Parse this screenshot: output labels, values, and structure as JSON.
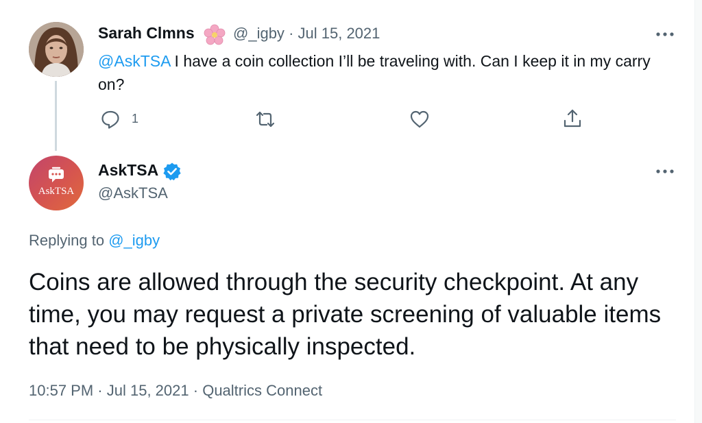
{
  "tweet1": {
    "display_name": "Sarah Clmns",
    "handle": "@_igby",
    "separator": "·",
    "date": "Jul 15, 2021",
    "mention": "@AskTSA",
    "text": " I have a coin collection I’ll be traveling with. Can I keep it in my carry on?",
    "reply_count": "1",
    "icons": [
      "flower-emoji",
      "more-icon",
      "reply-icon",
      "retweet-icon",
      "like-icon",
      "share-icon"
    ]
  },
  "tweet2": {
    "display_name": "AskTSA",
    "handle": "@AskTSA",
    "avatar_text": "AskTSA",
    "replying_to_label": "Replying to",
    "replying_to_handle": "@_igby",
    "text": "Coins are allowed through the security checkpoint. At any time, you may request a private screening of valuable items that need to be physically inspected.",
    "time": "10:57 PM",
    "separator": "·",
    "date": "Jul 15, 2021",
    "source": "Qualtrics Connect",
    "icons": [
      "verified-badge-icon",
      "more-icon"
    ]
  },
  "colors": {
    "accent": "#1d9bf0",
    "text": "#0f1419",
    "secondary": "#536471",
    "tsa_avatar": "#d6554f"
  }
}
